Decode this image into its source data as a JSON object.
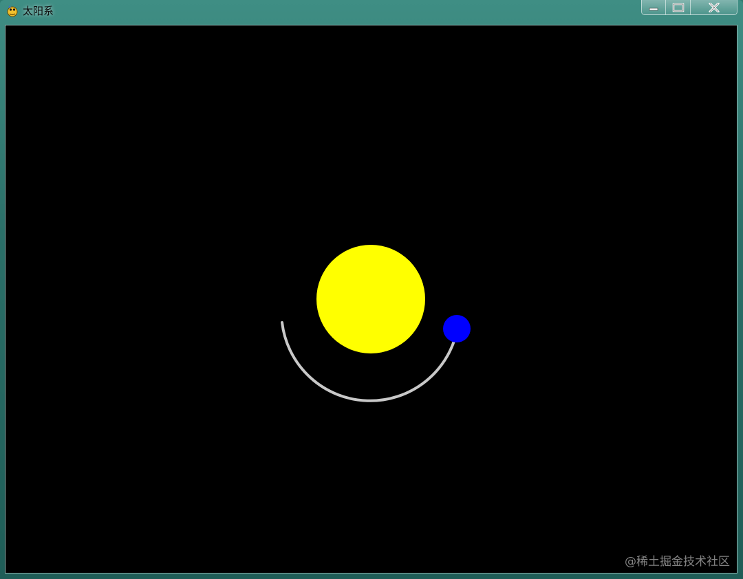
{
  "window": {
    "title": "太阳系",
    "app_icon": "pygame-snake-icon",
    "controls": {
      "minimize": "minimize-icon",
      "maximize": "maximize-icon",
      "close": "close-icon"
    }
  },
  "scene": {
    "background_color": "#000000",
    "sun_color": "#ffff00",
    "planet_color": "#0000ff",
    "orbit_trail_color": "#c8c8c8"
  },
  "watermark": "@稀土掘金技术社区"
}
